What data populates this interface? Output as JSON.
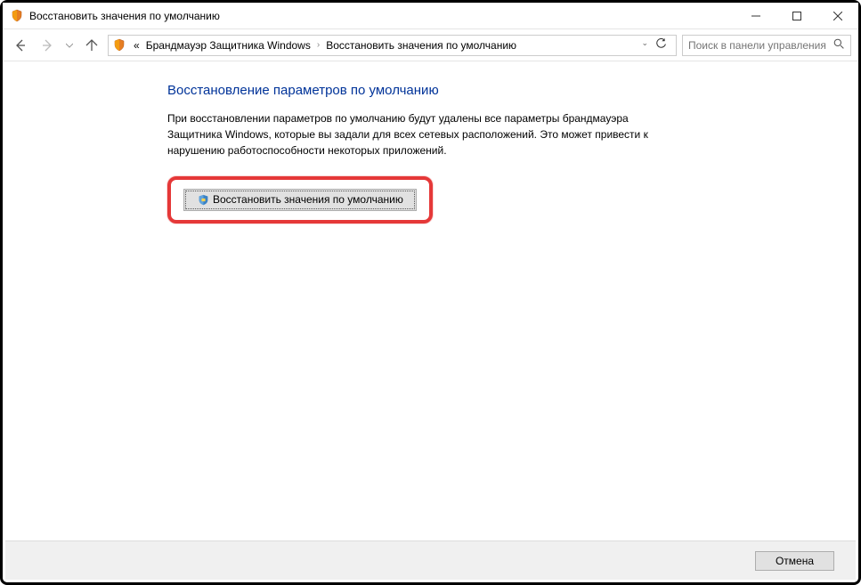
{
  "titlebar": {
    "title": "Восстановить значения по умолчанию"
  },
  "navbar": {
    "breadcrumb_prefix": "«",
    "breadcrumb_item1": "Брандмауэр Защитника Windows",
    "breadcrumb_item2": "Восстановить значения по умолчанию",
    "search_placeholder": "Поиск в панели управления"
  },
  "content": {
    "heading": "Восстановление параметров по умолчанию",
    "body": "При восстановлении параметров по умолчанию будут удалены все параметры брандмауэра Защитника Windows, которые вы задали для всех сетевых расположений. Это может привести к нарушению работоспособности некоторых приложений.",
    "restore_button": "Восстановить значения по умолчанию"
  },
  "footer": {
    "cancel": "Отмена"
  }
}
